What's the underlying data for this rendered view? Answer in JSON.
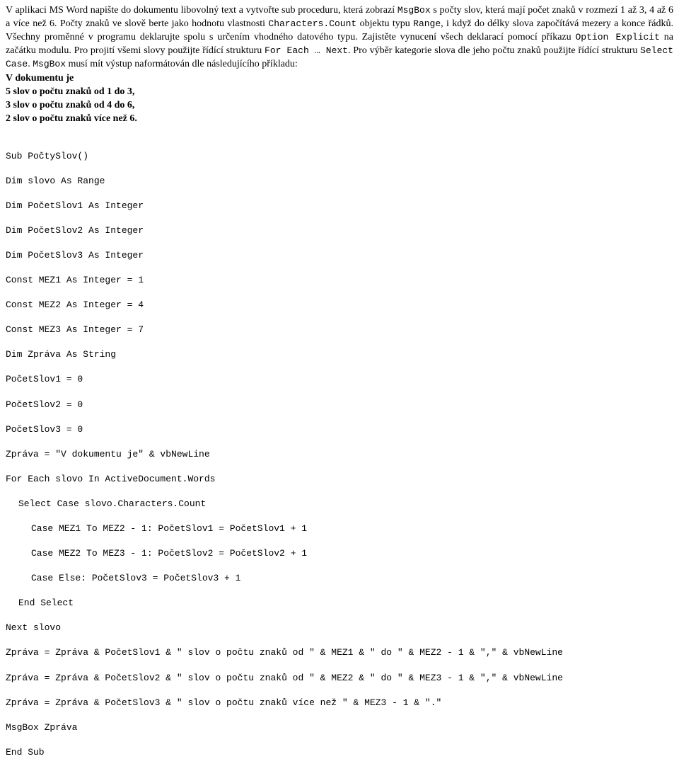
{
  "paragraph": {
    "s1a": "V aplikaci MS Word napište do dokumentu libovolný text a vytvořte sub proceduru, která zobrazí ",
    "s1b": "MsgBox",
    "s1c": " s počty slov, která mají počet znaků v rozmezí 1 až 3, 4 až 6 a více než 6. Počty znaků ve slově berte jako hodnotu vlastnosti ",
    "s1d": "Characters.Count",
    "s1e": " objektu typu ",
    "s1f": "Range",
    "s1g": ", i když do délky slova započítává mezery a konce řádků. Všechny proměnné v programu deklarujte spolu s určením vhodného datového typu. Zajistěte vynucení všech deklarací pomocí příkazu ",
    "s1h": "Option Explicit",
    "s1i": " na začátku modulu. Pro projití všemi slovy použijte řídící strukturu ",
    "s1j": "For Each … Next",
    "s1k": ". Pro výběr kategorie slova dle jeho počtu znaků použijte řídící strukturu ",
    "s1l": "Select Case",
    "s1m": ". ",
    "s1n": "MsgBox",
    "s1o": " musí mít výstup naformátován dle následujícího příkladu:"
  },
  "example": {
    "l1": "V dokumentu je",
    "l2": "5 slov o počtu znaků od 1 do 3,",
    "l3": "3 slov o počtu znaků od 4 do 6,",
    "l4": "2 slov o počtu znaků více než 6."
  },
  "code": {
    "c1": "Sub PočtySlov()",
    "c2": "Dim slovo As Range",
    "c3": "Dim PočetSlov1 As Integer",
    "c4": "Dim PočetSlov2 As Integer",
    "c5": "Dim PočetSlov3 As Integer",
    "c6": "Const MEZ1 As Integer = 1",
    "c7": "Const MEZ2 As Integer = 4",
    "c8": "Const MEZ3 As Integer = 7",
    "c9": "Dim Zpráva As String",
    "c10": "PočetSlov1 = 0",
    "c11": "PočetSlov2 = 0",
    "c12": "PočetSlov3 = 0",
    "c13": "Zpráva = \"V dokumentu je\" & vbNewLine",
    "c14": "For Each slovo In ActiveDocument.Words",
    "c15": "Select Case slovo.Characters.Count",
    "c16": "Case MEZ1 To MEZ2 - 1: PočetSlov1 = PočetSlov1 + 1",
    "c17": "Case MEZ2 To MEZ3 - 1: PočetSlov2 = PočetSlov2 + 1",
    "c18": "Case Else: PočetSlov3 = PočetSlov3 + 1",
    "c19": "End Select",
    "c20": "Next slovo",
    "c21": "Zpráva = Zpráva & PočetSlov1 & \" slov o počtu znaků od \" & MEZ1 & \" do \" & MEZ2 - 1 & \",\" & vbNewLine",
    "c22": "Zpráva = Zpráva & PočetSlov2 & \" slov o počtu znaků od \" & MEZ2 & \" do \" & MEZ3 - 1 & \",\" & vbNewLine",
    "c23": "Zpráva = Zpráva & PočetSlov3 & \" slov o počtu znaků více než \" & MEZ3 - 1 & \".\"",
    "c24": "MsgBox Zpráva",
    "c25": "End Sub"
  }
}
